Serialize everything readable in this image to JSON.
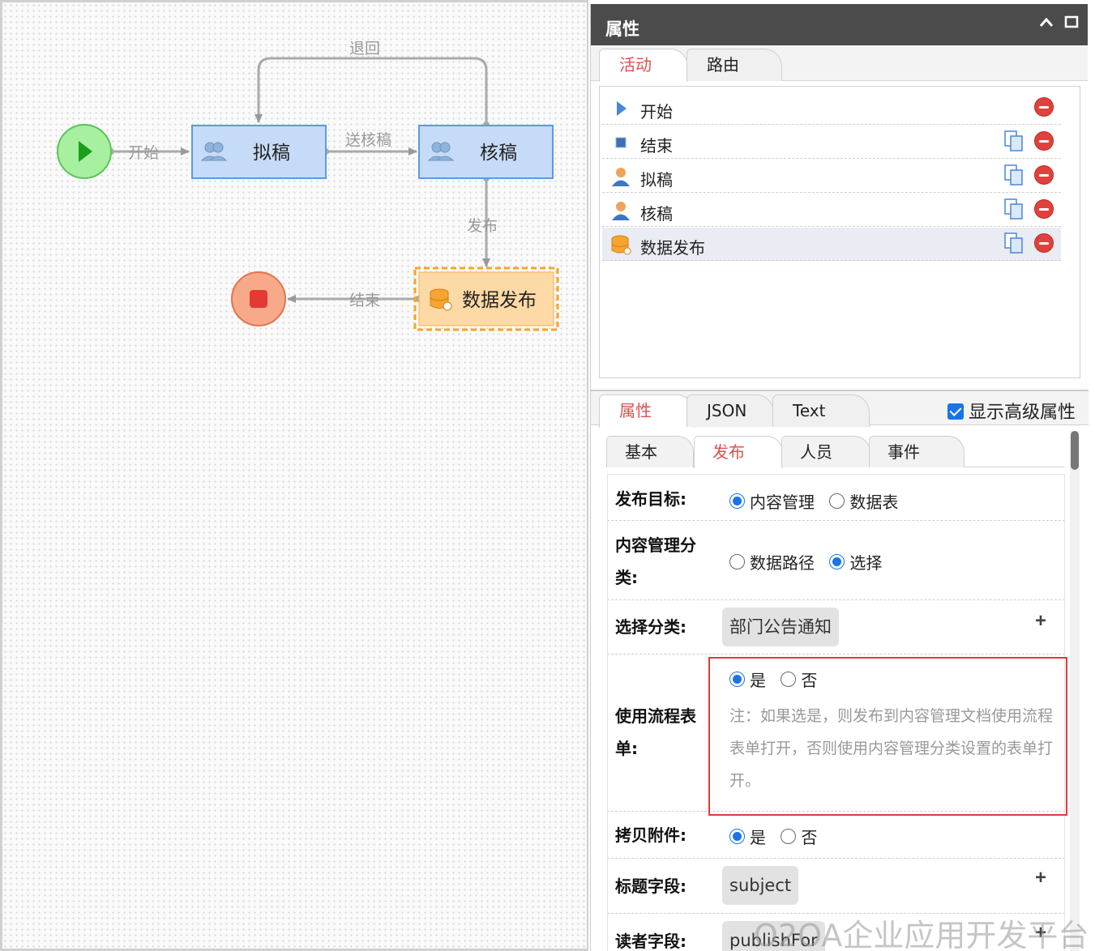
{
  "flow": {
    "edges": {
      "return_label": "退回",
      "start_label": "开始",
      "submit_label": "送核稿",
      "publish_label": "发布",
      "end_label": "结束"
    },
    "nodes": {
      "draft": "拟稿",
      "review": "核稿",
      "data_publish": "数据发布"
    }
  },
  "panel": {
    "title": "属性",
    "top_tabs": [
      "活动",
      "路由"
    ],
    "activities": [
      {
        "label": "开始",
        "icon": "start-triangle-icon"
      },
      {
        "label": "结束",
        "icon": "end-square-icon"
      },
      {
        "label": "拟稿",
        "icon": "person-icon"
      },
      {
        "label": "核稿",
        "icon": "person-icon"
      },
      {
        "label": "数据发布",
        "icon": "database-icon"
      }
    ],
    "bottom_tabs": [
      "属性",
      "JSON",
      "Text"
    ],
    "show_advanced": "显示高级属性",
    "sub_tabs": [
      "基本",
      "发布",
      "人员",
      "事件"
    ]
  },
  "form": {
    "publish_target": {
      "label": "发布目标:",
      "options": [
        "内容管理",
        "数据表"
      ],
      "selected": "内容管理"
    },
    "cms_category": {
      "label": "内容管理分类:",
      "options": [
        "数据路径",
        "选择"
      ],
      "selected": "选择"
    },
    "select_category": {
      "label": "选择分类:",
      "value": "部门公告通知"
    },
    "use_flow_form": {
      "label": "使用流程表单:",
      "options": [
        "是",
        "否"
      ],
      "selected": "是",
      "note": "注：如果选是，则发布到内容管理文档使用流程表单打开，否则使用内容管理分类设置的表单打开。"
    },
    "copy_attachments": {
      "label": "拷贝附件:",
      "options": [
        "是",
        "否"
      ],
      "selected": "是"
    },
    "title_field": {
      "label": "标题字段:",
      "value": "subject"
    },
    "reader_field": {
      "label": "读者字段:",
      "value": "publishFor"
    }
  },
  "watermark": "O2OA企业应用开发平台",
  "colors": {
    "accent_red": "#d9534f",
    "header": "#4b4b4b",
    "radio_blue": "#1a73e8",
    "highlight": "#e03b3b"
  }
}
